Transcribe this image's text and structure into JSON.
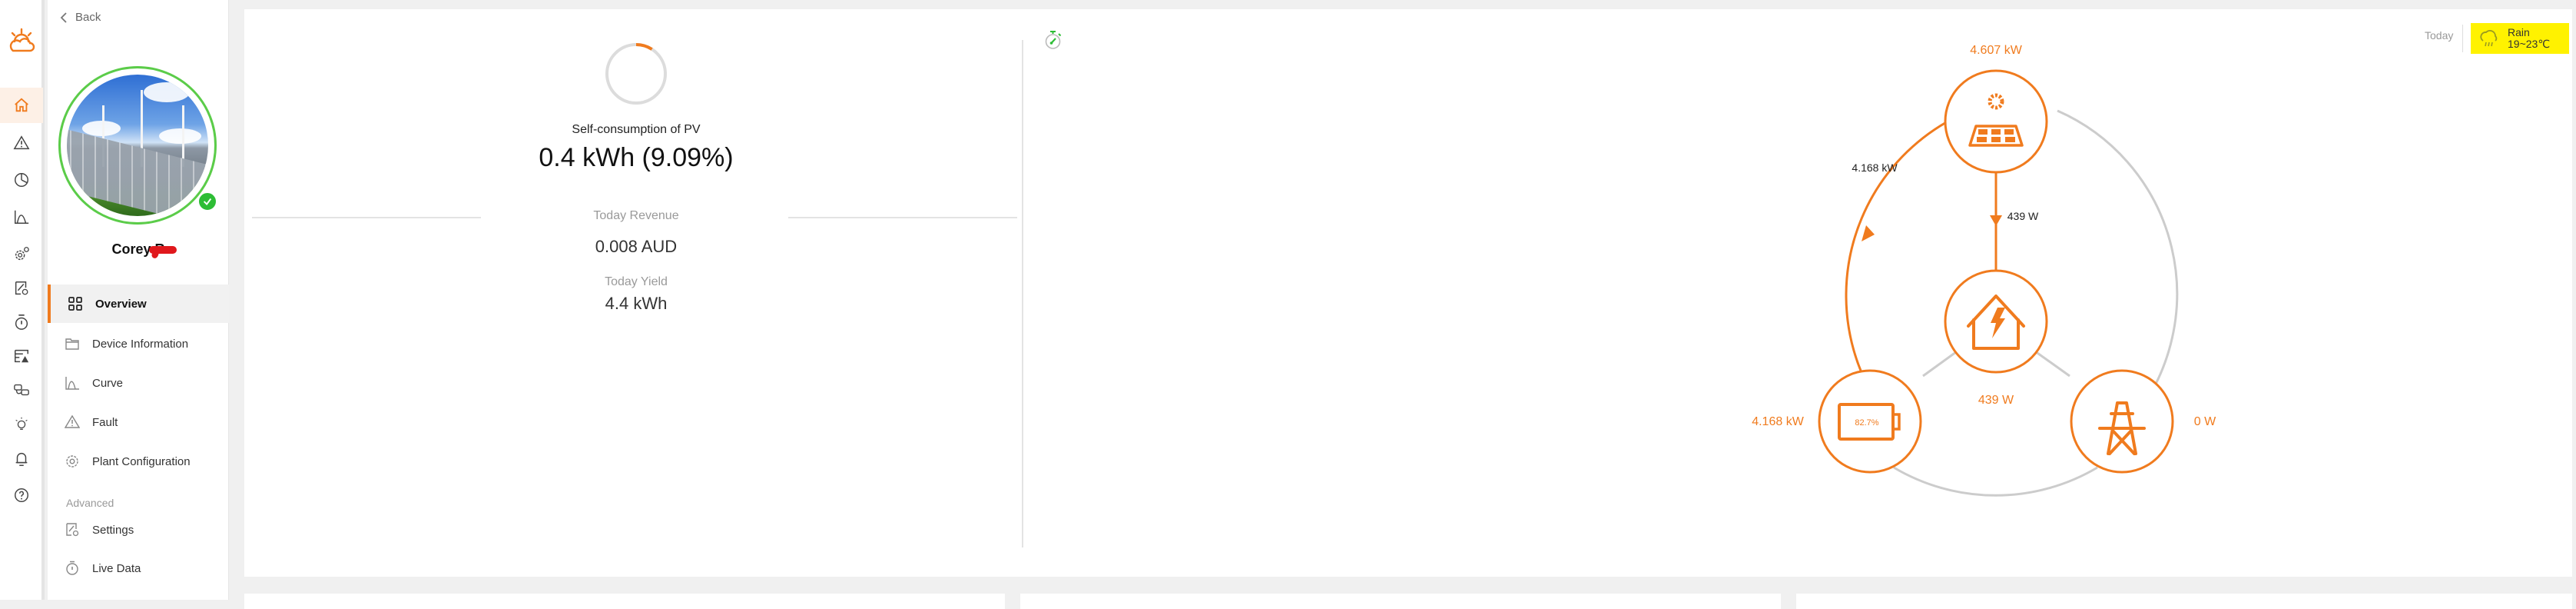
{
  "app": {
    "brand_icon": "sun-cloud-logo-icon",
    "accent_color": "#f07b1e",
    "online_color": "#2dbd35"
  },
  "rail": {
    "items": [
      {
        "name": "home",
        "icon": "home-icon",
        "active": true
      },
      {
        "name": "alarm",
        "icon": "warning-triangle-icon",
        "active": false
      },
      {
        "name": "statistics",
        "icon": "pie-chart-icon",
        "active": false
      },
      {
        "name": "curve",
        "icon": "curve-icon",
        "active": false
      },
      {
        "name": "device-settings",
        "icon": "gears-icon",
        "active": false
      },
      {
        "name": "parameter-settings",
        "icon": "settings-doc-icon",
        "active": false
      },
      {
        "name": "live-data",
        "icon": "stopwatch-icon",
        "active": false
      },
      {
        "name": "fault-log",
        "icon": "log-warning-icon",
        "active": false
      },
      {
        "name": "devices",
        "icon": "device-link-icon",
        "active": false
      },
      {
        "name": "tips",
        "icon": "lightbulb-icon",
        "active": false
      },
      {
        "name": "notifications",
        "icon": "bell-icon",
        "active": false
      },
      {
        "name": "help",
        "icon": "help-circle-icon",
        "active": false
      }
    ]
  },
  "nav": {
    "back_label": "Back",
    "user_name": "Corey R",
    "status": "online",
    "items": [
      {
        "label": "Overview",
        "icon": "grid-icon",
        "active": true
      },
      {
        "label": "Device Information",
        "icon": "folder-icon",
        "active": false
      },
      {
        "label": "Curve",
        "icon": "curve-icon",
        "active": false
      },
      {
        "label": "Fault",
        "icon": "warning-triangle-icon",
        "active": false
      },
      {
        "label": "Plant Configuration",
        "icon": "gear-icon",
        "active": false
      }
    ],
    "advanced_label": "Advanced",
    "advanced_items": [
      {
        "label": "Settings",
        "icon": "settings-doc-icon"
      },
      {
        "label": "Live Data",
        "icon": "stopwatch-icon"
      }
    ]
  },
  "summary": {
    "self_consumption_label": "Self-consumption of PV",
    "self_consumption_value": "0.4 kWh (9.09%)",
    "self_consumption_ratio": 0.0909,
    "today_revenue_label": "Today Revenue",
    "today_revenue_value": "0.008 AUD",
    "today_yield_label": "Today Yield",
    "today_yield_value": "4.4 kWh"
  },
  "header": {
    "period_label": "Today",
    "weather_condition": "Rain",
    "weather_temp": "19~23℃",
    "weather_icon": "rain-cloud-icon"
  },
  "energy_flow": {
    "pv_power": "4.607 kW",
    "pv_to_battery": "4.168 kW",
    "pv_to_home": "439 W",
    "home_load": "439 W",
    "battery_power": "4.168 kW",
    "battery_soc": "82.7%",
    "grid_power": "0 W",
    "active_color": "#f07b1e",
    "inactive_color": "#cccccc"
  }
}
